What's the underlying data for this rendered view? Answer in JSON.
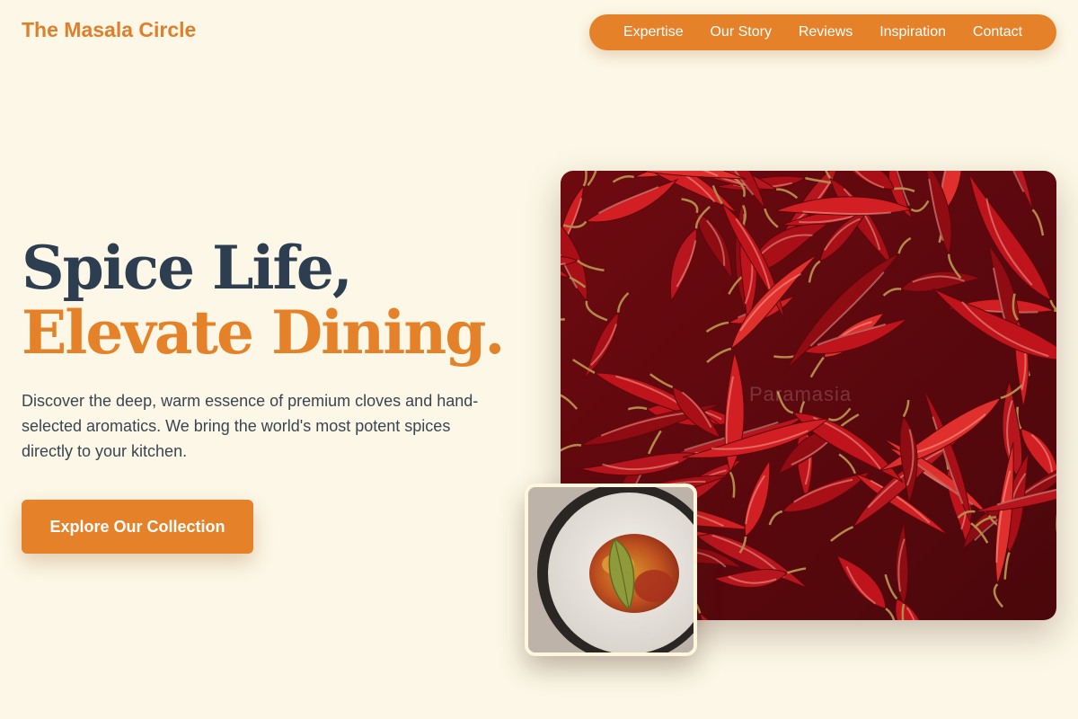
{
  "brand": {
    "name": "The Masala Circle"
  },
  "nav": {
    "items": [
      {
        "label": "Expertise"
      },
      {
        "label": "Our Story"
      },
      {
        "label": "Reviews"
      },
      {
        "label": "Inspiration"
      },
      {
        "label": "Contact"
      }
    ]
  },
  "hero": {
    "title_line1": "Spice Life,",
    "title_line2": "Elevate Dining.",
    "description": "Discover the deep, warm essence of premium cloves and hand-selected aromatics. We bring the world's most potent spices directly to your kitchen.",
    "cta_label": "Explore Our Collection"
  },
  "images": {
    "main": {
      "subject": "dried red chillies",
      "watermark": "Paramasia"
    },
    "thumb": {
      "subject": "bowl of ground spices with bay leaf"
    }
  },
  "colors": {
    "background": "#fcf7e6",
    "accent": "#e58229",
    "heading": "#2c3e50",
    "text": "#3a4552",
    "chili": "#b3121b"
  }
}
